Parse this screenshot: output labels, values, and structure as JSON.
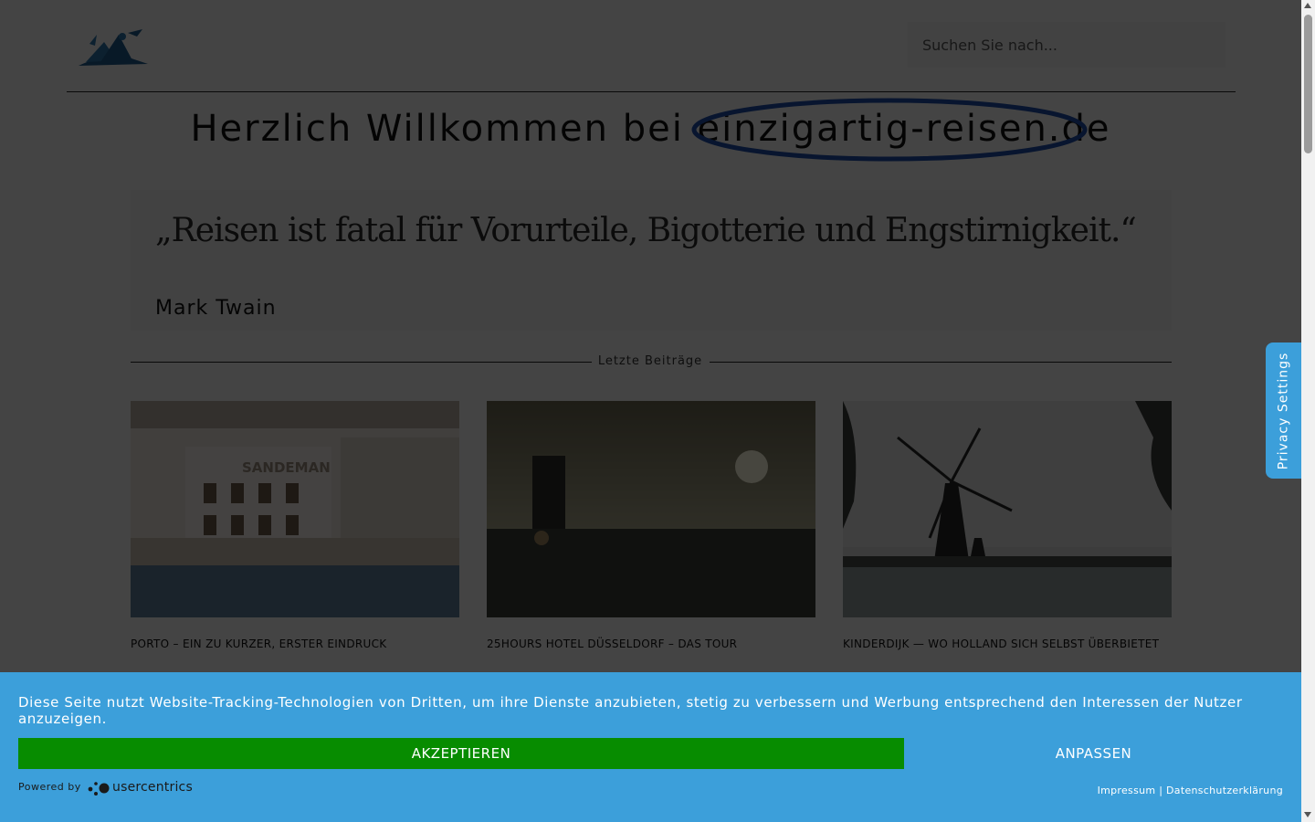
{
  "search": {
    "placeholder": "Suchen Sie nach..."
  },
  "welcome": {
    "prefix": "Herzlich Willkommen bei",
    "site": "einzigartig-reisen.de"
  },
  "quote": {
    "text": "„Reisen ist fatal für Vorurteile, Bigotterie und Engstirnigkeit.“",
    "author": "Mark Twain"
  },
  "section": {
    "title": "Letzte Beiträge"
  },
  "posts": [
    {
      "title": "PORTO – EIN ZU KURZER, ERSTER EINDRUCK",
      "image_sign": "SANDEMAN"
    },
    {
      "title": "25HOURS HOTEL DÜSSELDORF – DAS TOUR"
    },
    {
      "title": "KINDERDIJK — WO HOLLAND SICH SELBST ÜBERBIETET"
    }
  ],
  "privacy_tab": {
    "label": "Privacy Settings"
  },
  "cookie": {
    "text": "Diese Seite nutzt Website-Tracking-Technologien von Dritten, um ihre Dienste anzubieten, stetig zu verbessern und Werbung entsprechend den Interessen der Nutzer anzuzeigen.",
    "accept_label": "AKZEPTIEREN",
    "adjust_label": "ANPASSEN",
    "powered_by": "Powered by",
    "brand": "usercentrics",
    "impressum": "Impressum",
    "separator": "|",
    "datenschutz": "Datenschutzerklärung"
  },
  "colors": {
    "accent": "#3c9fda",
    "accept": "#078c00",
    "logo": "#1e5a8c"
  }
}
